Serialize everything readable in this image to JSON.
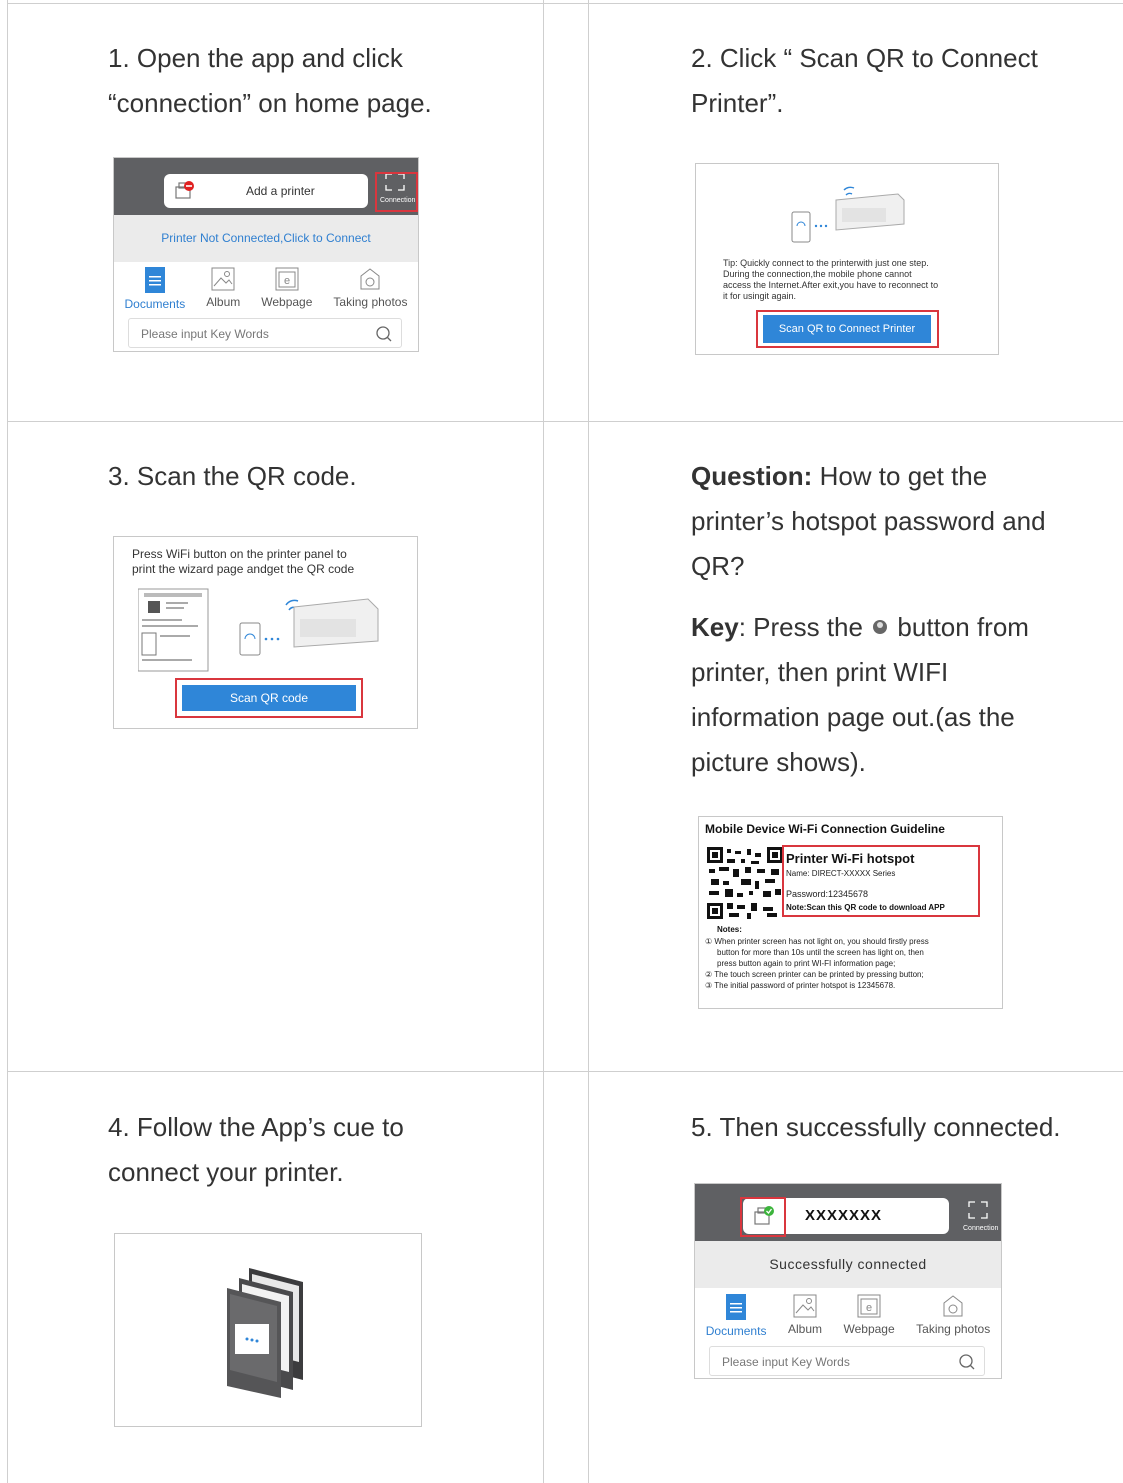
{
  "steps": {
    "s1": {
      "text_line1": "1. Open the app and click",
      "text_line2": "“connection” on home page."
    },
    "s2": {
      "text_line1": "2. Click “ Scan QR to Connect",
      "text_line2": "Printer”."
    },
    "s3": {
      "text": "3. Scan the QR code."
    },
    "s4": {
      "text_line1": "4. Follow the App’s cue to",
      "text_line2": "connect your printer."
    },
    "s5": {
      "text": "5. Then successfully connected."
    }
  },
  "question": {
    "q_label": "Question:",
    "q_line1": " How to get the",
    "q_line2": "printer’s hotspot password and",
    "q_line3": "QR?",
    "k_label": "Key",
    "k_line1a": ": Press the ",
    "k_line1b": " button from",
    "k_line2": "printer, then print WIFI",
    "k_line3": "information page out.(as the",
    "k_line4": "picture shows)."
  },
  "app_home": {
    "add_printer": "Add a printer",
    "connection": "Connection",
    "not_connected": "Printer Not Connected,Click  to  Connect",
    "tabs": [
      "Documents",
      "Album",
      "Webpage",
      "Taking photos"
    ],
    "webpage_icon_letter": "e",
    "search_placeholder": "Please input Key Words"
  },
  "scan_connect": {
    "tip_line1": "Tip: Quickly connect to the printerwith just one step.",
    "tip_line2": "During the connection,the mobile phone cannot",
    "tip_line3": "access the Internet.After exit,you have to reconnect to",
    "tip_line4": "it for usingit again.",
    "button": "Scan QR to Connect Printer"
  },
  "scan_qr": {
    "line1": "Press WiFi button on the printer panel to",
    "line2": "print the wizard page andget the QR code",
    "button": "Scan QR code"
  },
  "wifi_page": {
    "title": "Mobile Device Wi-Fi Connection Guideline",
    "hotspot_title": "Printer Wi-Fi hotspot",
    "name": "Name: DIRECT-XXXXX Series",
    "password": "Password:12345678",
    "note": "Note:Scan this QR code to download APP",
    "notes_label": "Notes:",
    "n1a": "① When printer screen has not light on, you should firstly press",
    "n1b": "button for more than 10s until the screen has light on, then",
    "n1c": "press    button again to print WI-FI information page;",
    "n2": "② The touch screen printer can be printed by pressing     button;",
    "n3": "③ The initial password of printer hotspot is 12345678."
  },
  "connected": {
    "name": "XXXXXXX",
    "connection": "Connection",
    "status": "Successfully  connected",
    "tabs": [
      "Documents",
      "Album",
      "Webpage",
      "Taking photos"
    ],
    "webpage_icon_letter": "e",
    "search_placeholder": "Please input Key Words"
  },
  "colors": {
    "accent_blue": "#2f86d8",
    "highlight_red": "#d9363e",
    "appbar_gray": "#5f6063"
  }
}
